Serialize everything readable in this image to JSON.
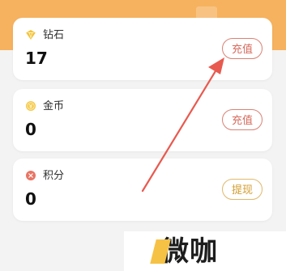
{
  "wallet": {
    "items": [
      {
        "label": "钻石",
        "value": "17",
        "button_label": "充值",
        "icon": "diamond-icon"
      },
      {
        "label": "金币",
        "value": "0",
        "button_label": "充值",
        "icon": "coin-icon"
      },
      {
        "label": "积分",
        "value": "0",
        "button_label": "提现",
        "icon": "points-icon"
      }
    ]
  },
  "watermark": {
    "text": "微咖"
  },
  "colors": {
    "header": "#f6b25f",
    "background": "#f3f3f3",
    "card": "#ffffff",
    "recharge_button": "#d98274",
    "withdraw_button": "#e0b86b",
    "arrow": "#e85a4f"
  }
}
